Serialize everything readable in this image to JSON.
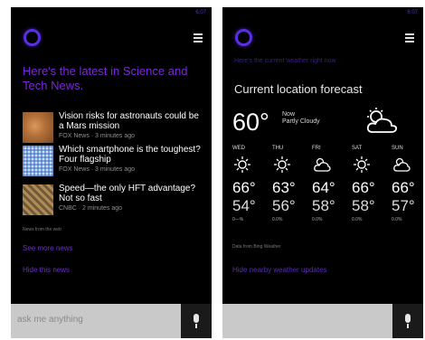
{
  "accent_color": "#7a28d8",
  "left": {
    "clock": "6:07",
    "headline": "Here's the latest in Science and Tech News.",
    "news": [
      {
        "title": "Vision risks for astronauts could be a Mars mission",
        "source": "FOX News · 3 minutes ago"
      },
      {
        "title": "Which smartphone is the toughest? Four flagship",
        "source": "FOX News · 3 minutes ago"
      },
      {
        "title": "Speed—the only HFT advantage? Not so fast",
        "source": "CNBC · 2 minutes ago"
      }
    ],
    "credit": "News from the web",
    "link1": "See more news",
    "link2": "Hide this news",
    "ask_placeholder": "ask me anything"
  },
  "right": {
    "clock": "6:07",
    "faded_line": "Here's the current weather right now",
    "title": "Current location forecast",
    "now_temp": "60°",
    "now_label": "Now",
    "now_condition": "Partly Cloudy",
    "days": [
      {
        "name": "WED",
        "icon": "sun-icon",
        "hi": "66°",
        "lo": "54°",
        "pct": "0—%"
      },
      {
        "name": "THU",
        "icon": "sun-icon",
        "hi": "63°",
        "lo": "56°",
        "pct": "0.0%"
      },
      {
        "name": "FRI",
        "icon": "partly-cloudy-icon",
        "hi": "64°",
        "lo": "58°",
        "pct": "0.0%"
      },
      {
        "name": "SAT",
        "icon": "sun-icon",
        "hi": "66°",
        "lo": "58°",
        "pct": "0.0%"
      },
      {
        "name": "SUN",
        "icon": "partly-cloudy-icon",
        "hi": "66°",
        "lo": "57°",
        "pct": "0.0%"
      }
    ],
    "source": "Data from Bing Weather",
    "link": "Hide nearby weather updates",
    "ask_placeholder": ""
  }
}
